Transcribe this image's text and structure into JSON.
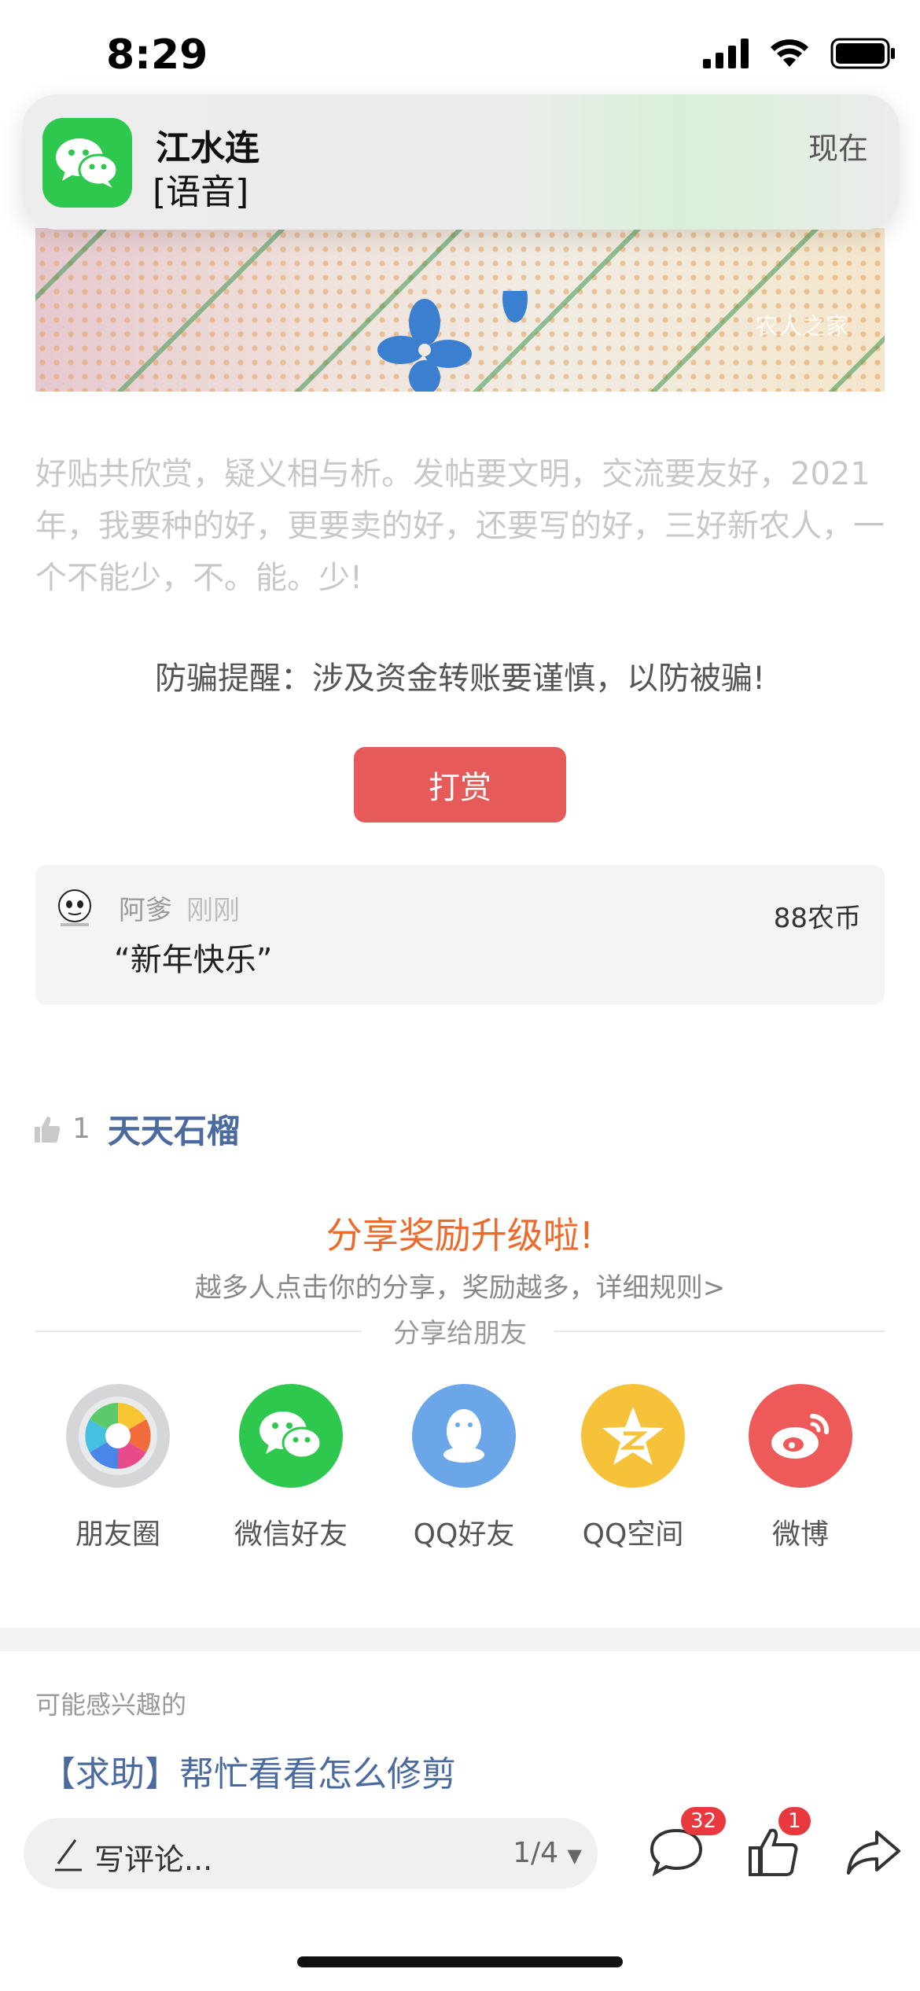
{
  "status_bar": {
    "time": "8:29"
  },
  "notification": {
    "app_icon": "wechat-icon",
    "title": "江水连",
    "body": "[语音]",
    "time": "现在",
    "accent": "#2dc84d"
  },
  "photo": {
    "watermark": "农人之家"
  },
  "post": {
    "signature": "好贴共欣赏，疑义相与析。发帖要文明，交流要友好，2021年，我要种的好，更要卖的好，还要写的好，三好新农人，一个不能少，不。能。少!",
    "fraud_warning": "防骗提醒：涉及资金转账要谨慎，以防被骗!"
  },
  "reward": {
    "button_label": "打赏",
    "button_color": "#e65a5a"
  },
  "tip": {
    "user": "阿爹",
    "time": "刚刚",
    "amount": "88农币",
    "message": "“新年快乐”"
  },
  "likes": {
    "count": "1",
    "user": "天天石榴"
  },
  "share": {
    "title": "分享奖励升级啦!",
    "subtitle": "越多人点击你的分享，奖励越多，详细规则>",
    "friends_label": "分享给朋友",
    "targets": [
      {
        "label": "朋友圈",
        "icon": "moments-icon",
        "color": "#d4d6d8"
      },
      {
        "label": "微信好友",
        "icon": "wechat-icon",
        "color": "#2dc84d"
      },
      {
        "label": "QQ好友",
        "icon": "qq-icon",
        "color": "#6aa6e8"
      },
      {
        "label": "QQ空间",
        "icon": "qzone-icon",
        "color": "#f6c23a"
      },
      {
        "label": "微博",
        "icon": "weibo-icon",
        "color": "#ee5a5a"
      }
    ]
  },
  "recommend": {
    "title": "可能感兴趣的",
    "item": "【求助】帮忙看看怎么修剪"
  },
  "bottom_bar": {
    "placeholder": "写评论...",
    "page": "1/4",
    "comment_count": "32",
    "like_count": "1"
  }
}
